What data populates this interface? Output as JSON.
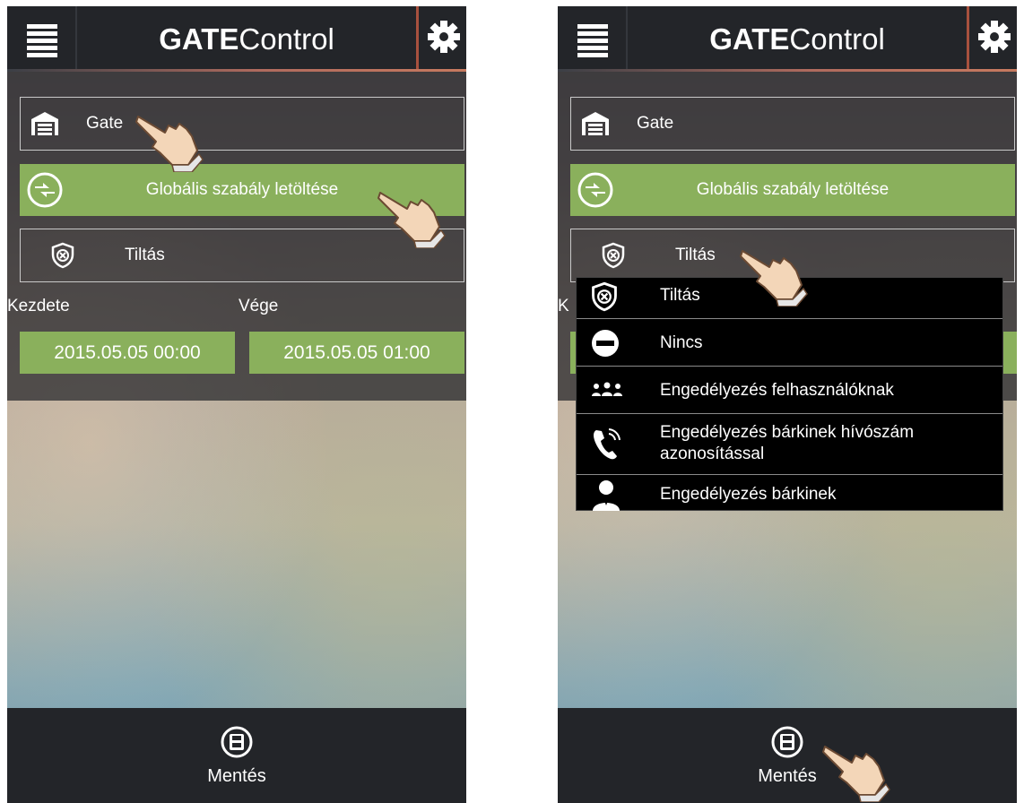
{
  "app": {
    "title_bold": "GATE",
    "title_light": "Control"
  },
  "gate_field": {
    "label": "Gate"
  },
  "global_rule_button": {
    "label": "Globális szabály letöltése"
  },
  "rule_select": {
    "selected": "Tiltás"
  },
  "dates": {
    "start_label": "Kezdete",
    "end_label": "Vége",
    "start_value": "2015.05.05 00:00",
    "end_value": "2015.05.05 01:00",
    "partial_start_label": "K"
  },
  "save": {
    "label": "Mentés"
  },
  "dropdown": {
    "options": [
      {
        "label": "Tiltás",
        "icon": "shield-x-icon"
      },
      {
        "label": "Nincs",
        "icon": "minus-circle-icon"
      },
      {
        "label": "Engedélyezés felhasználóknak",
        "icon": "users-icon"
      },
      {
        "label_line1": "Engedélyezés bárkinek hívószám",
        "label_line2": "azonosítással",
        "icon": "phone-call-icon"
      },
      {
        "label": "Engedélyezés bárkinek",
        "icon": "person-icon"
      }
    ]
  },
  "colors": {
    "accent_green": "#8ab05c",
    "bar_dark": "#232529",
    "gear_border": "#a8513e"
  }
}
